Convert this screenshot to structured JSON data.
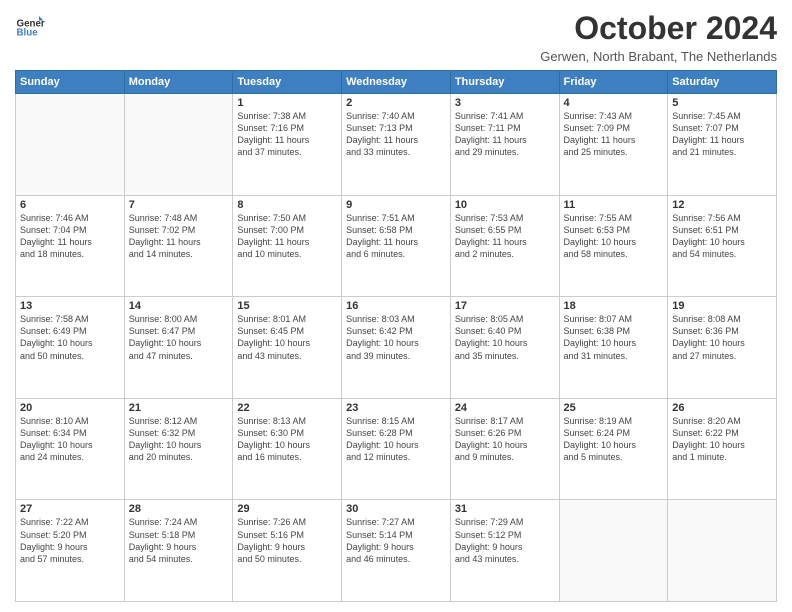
{
  "header": {
    "logo_line1": "General",
    "logo_line2": "Blue",
    "month_title": "October 2024",
    "location": "Gerwen, North Brabant, The Netherlands"
  },
  "weekdays": [
    "Sunday",
    "Monday",
    "Tuesday",
    "Wednesday",
    "Thursday",
    "Friday",
    "Saturday"
  ],
  "weeks": [
    [
      {
        "day": "",
        "info": ""
      },
      {
        "day": "",
        "info": ""
      },
      {
        "day": "1",
        "info": "Sunrise: 7:38 AM\nSunset: 7:16 PM\nDaylight: 11 hours\nand 37 minutes."
      },
      {
        "day": "2",
        "info": "Sunrise: 7:40 AM\nSunset: 7:13 PM\nDaylight: 11 hours\nand 33 minutes."
      },
      {
        "day": "3",
        "info": "Sunrise: 7:41 AM\nSunset: 7:11 PM\nDaylight: 11 hours\nand 29 minutes."
      },
      {
        "day": "4",
        "info": "Sunrise: 7:43 AM\nSunset: 7:09 PM\nDaylight: 11 hours\nand 25 minutes."
      },
      {
        "day": "5",
        "info": "Sunrise: 7:45 AM\nSunset: 7:07 PM\nDaylight: 11 hours\nand 21 minutes."
      }
    ],
    [
      {
        "day": "6",
        "info": "Sunrise: 7:46 AM\nSunset: 7:04 PM\nDaylight: 11 hours\nand 18 minutes."
      },
      {
        "day": "7",
        "info": "Sunrise: 7:48 AM\nSunset: 7:02 PM\nDaylight: 11 hours\nand 14 minutes."
      },
      {
        "day": "8",
        "info": "Sunrise: 7:50 AM\nSunset: 7:00 PM\nDaylight: 11 hours\nand 10 minutes."
      },
      {
        "day": "9",
        "info": "Sunrise: 7:51 AM\nSunset: 6:58 PM\nDaylight: 11 hours\nand 6 minutes."
      },
      {
        "day": "10",
        "info": "Sunrise: 7:53 AM\nSunset: 6:55 PM\nDaylight: 11 hours\nand 2 minutes."
      },
      {
        "day": "11",
        "info": "Sunrise: 7:55 AM\nSunset: 6:53 PM\nDaylight: 10 hours\nand 58 minutes."
      },
      {
        "day": "12",
        "info": "Sunrise: 7:56 AM\nSunset: 6:51 PM\nDaylight: 10 hours\nand 54 minutes."
      }
    ],
    [
      {
        "day": "13",
        "info": "Sunrise: 7:58 AM\nSunset: 6:49 PM\nDaylight: 10 hours\nand 50 minutes."
      },
      {
        "day": "14",
        "info": "Sunrise: 8:00 AM\nSunset: 6:47 PM\nDaylight: 10 hours\nand 47 minutes."
      },
      {
        "day": "15",
        "info": "Sunrise: 8:01 AM\nSunset: 6:45 PM\nDaylight: 10 hours\nand 43 minutes."
      },
      {
        "day": "16",
        "info": "Sunrise: 8:03 AM\nSunset: 6:42 PM\nDaylight: 10 hours\nand 39 minutes."
      },
      {
        "day": "17",
        "info": "Sunrise: 8:05 AM\nSunset: 6:40 PM\nDaylight: 10 hours\nand 35 minutes."
      },
      {
        "day": "18",
        "info": "Sunrise: 8:07 AM\nSunset: 6:38 PM\nDaylight: 10 hours\nand 31 minutes."
      },
      {
        "day": "19",
        "info": "Sunrise: 8:08 AM\nSunset: 6:36 PM\nDaylight: 10 hours\nand 27 minutes."
      }
    ],
    [
      {
        "day": "20",
        "info": "Sunrise: 8:10 AM\nSunset: 6:34 PM\nDaylight: 10 hours\nand 24 minutes."
      },
      {
        "day": "21",
        "info": "Sunrise: 8:12 AM\nSunset: 6:32 PM\nDaylight: 10 hours\nand 20 minutes."
      },
      {
        "day": "22",
        "info": "Sunrise: 8:13 AM\nSunset: 6:30 PM\nDaylight: 10 hours\nand 16 minutes."
      },
      {
        "day": "23",
        "info": "Sunrise: 8:15 AM\nSunset: 6:28 PM\nDaylight: 10 hours\nand 12 minutes."
      },
      {
        "day": "24",
        "info": "Sunrise: 8:17 AM\nSunset: 6:26 PM\nDaylight: 10 hours\nand 9 minutes."
      },
      {
        "day": "25",
        "info": "Sunrise: 8:19 AM\nSunset: 6:24 PM\nDaylight: 10 hours\nand 5 minutes."
      },
      {
        "day": "26",
        "info": "Sunrise: 8:20 AM\nSunset: 6:22 PM\nDaylight: 10 hours\nand 1 minute."
      }
    ],
    [
      {
        "day": "27",
        "info": "Sunrise: 7:22 AM\nSunset: 5:20 PM\nDaylight: 9 hours\nand 57 minutes."
      },
      {
        "day": "28",
        "info": "Sunrise: 7:24 AM\nSunset: 5:18 PM\nDaylight: 9 hours\nand 54 minutes."
      },
      {
        "day": "29",
        "info": "Sunrise: 7:26 AM\nSunset: 5:16 PM\nDaylight: 9 hours\nand 50 minutes."
      },
      {
        "day": "30",
        "info": "Sunrise: 7:27 AM\nSunset: 5:14 PM\nDaylight: 9 hours\nand 46 minutes."
      },
      {
        "day": "31",
        "info": "Sunrise: 7:29 AM\nSunset: 5:12 PM\nDaylight: 9 hours\nand 43 minutes."
      },
      {
        "day": "",
        "info": ""
      },
      {
        "day": "",
        "info": ""
      }
    ]
  ]
}
